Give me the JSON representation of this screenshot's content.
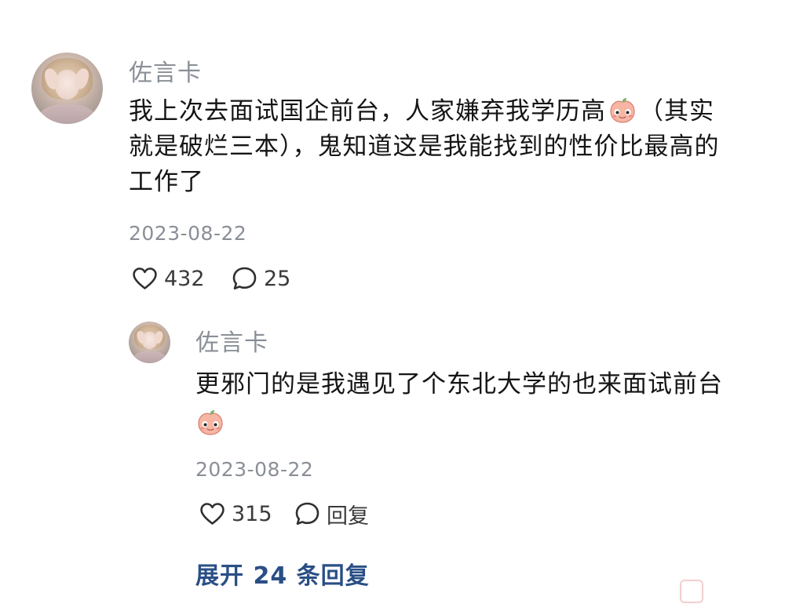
{
  "comment": {
    "username": "佐言卡",
    "text_line1": "我上次去面试国企前台，人家嫌弃我学历高",
    "text_line1_tail": "（其实",
    "text_line2": "就是破烂三本），鬼知道这是我能找到的性价比最高的",
    "text_line3": "工作了",
    "emoji": "peach-face-emoji",
    "date": "2023-08-22",
    "likes": "432",
    "replies": "25"
  },
  "reply": {
    "username": "佐言卡",
    "text_line1": "更邪门的是我遇见了个东北大学的也来面试前台",
    "emoji": "peach-face-emoji",
    "date": "2023-08-22",
    "likes": "315",
    "reply_label": "回复"
  },
  "expand_label": "展开 24 条回复",
  "colors": {
    "username": "#8a8f97",
    "text": "#151515",
    "date": "#8a8f97",
    "link": "#2a4f86"
  },
  "icons": {
    "like": "heart-outline-icon",
    "comment": "speech-bubble-outline-icon"
  }
}
